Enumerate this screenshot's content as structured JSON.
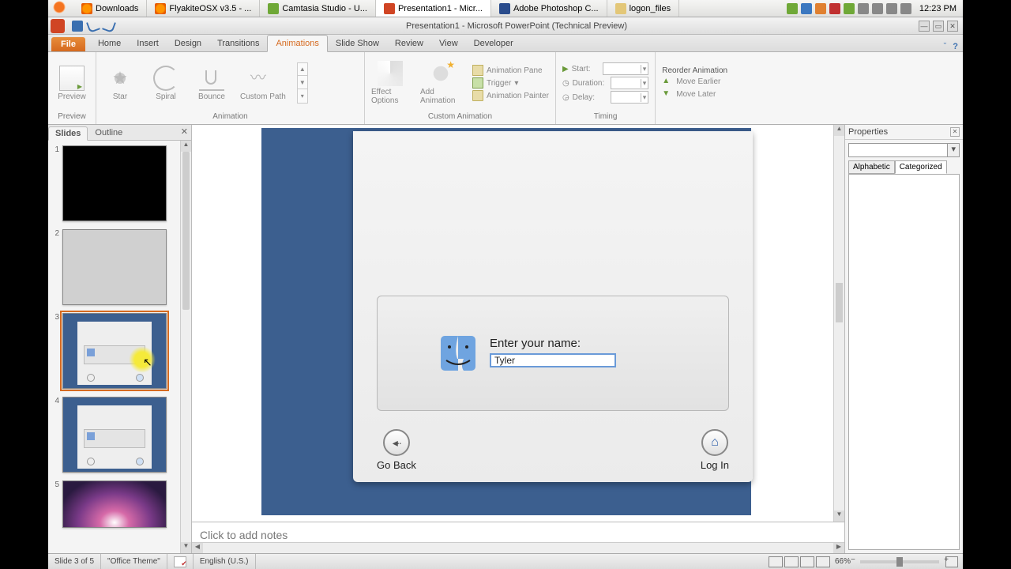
{
  "gnome": {
    "tabs": [
      {
        "label": "Downloads",
        "icon": "ff"
      },
      {
        "label": "FlyakiteOSX v3.5 - ...",
        "icon": "ff"
      },
      {
        "label": "Camtasia Studio - U...",
        "icon": "cam"
      },
      {
        "label": "Presentation1 - Micr...",
        "icon": "ppt",
        "active": true
      },
      {
        "label": "Adobe Photoshop C...",
        "icon": "ps"
      },
      {
        "label": "logon_files",
        "icon": "folder"
      }
    ],
    "clock": "12:23 PM"
  },
  "titlebar": {
    "title": "Presentation1 - Microsoft PowerPoint (Technical Preview)"
  },
  "ribbon": {
    "file": "File",
    "tabs": [
      "Home",
      "Insert",
      "Design",
      "Transitions",
      "Animations",
      "Slide Show",
      "Review",
      "View",
      "Developer"
    ],
    "active": "Animations",
    "preview": {
      "btn": "Preview",
      "group": "Preview"
    },
    "gallery": {
      "items": [
        "Star",
        "Spiral",
        "Bounce",
        "Custom Path"
      ],
      "group": "Animation"
    },
    "effect": {
      "effect": "Effect Options",
      "add": "Add Animation",
      "pane": "Animation Pane",
      "trigger": "Trigger",
      "painter": "Animation Painter",
      "group": "Custom Animation"
    },
    "timing": {
      "start": "Start:",
      "duration": "Duration:",
      "delay": "Delay:",
      "group": "Timing"
    },
    "reorder": {
      "title": "Reorder Animation",
      "earlier": "Move Earlier",
      "later": "Move Later"
    }
  },
  "slidesPanel": {
    "slides": "Slides",
    "outline": "Outline",
    "count": 5
  },
  "slide": {
    "enter": "Enter your name:",
    "value": "Tyler",
    "goback": "Go Back",
    "login": "Log In"
  },
  "notes": {
    "placeholder": "Click to add notes"
  },
  "props": {
    "title": "Properties",
    "alpha": "Alphabetic",
    "cat": "Categorized"
  },
  "status": {
    "slide": "Slide 3 of 5",
    "theme": "\"Office Theme\"",
    "lang": "English (U.S.)",
    "zoom": "66%"
  }
}
